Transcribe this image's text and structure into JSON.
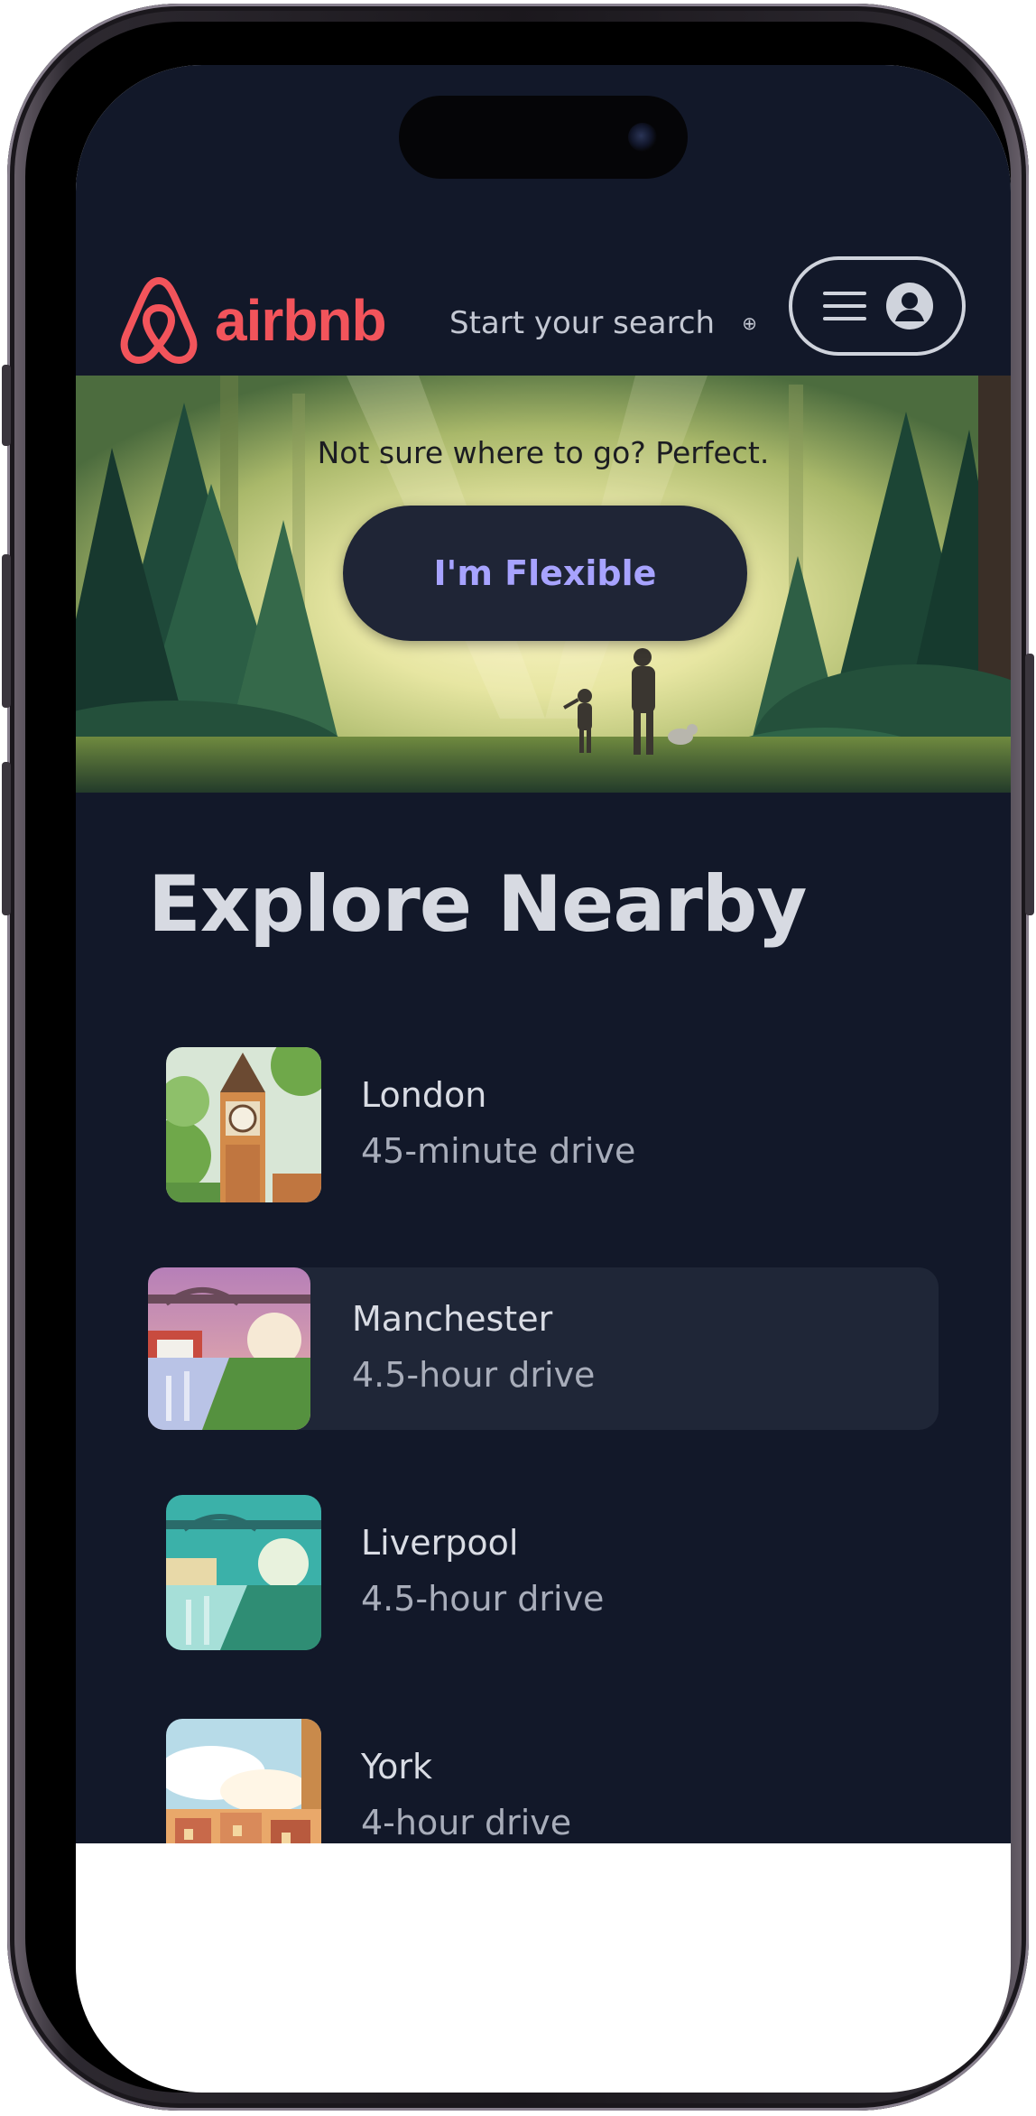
{
  "header": {
    "logo_text": "airbnb",
    "search_placeholder": "Start your search",
    "icons": [
      "airbnb-logo-icon",
      "globe-icon",
      "hamburger-menu-icon",
      "user-avatar-icon"
    ]
  },
  "hero": {
    "prompt": "Not sure where to go? Perfect.",
    "button_label": "I'm Flexible"
  },
  "explore": {
    "title": "Explore Nearby",
    "items": [
      {
        "name": "London",
        "drive": "45-minute drive"
      },
      {
        "name": "Manchester",
        "drive": "4.5-hour drive"
      },
      {
        "name": "Liverpool",
        "drive": "4.5-hour drive"
      },
      {
        "name": "York",
        "drive": "4-hour drive"
      }
    ]
  },
  "colors": {
    "background": "#121829",
    "brand": "#f2545b",
    "button_text": "#a7a3ff",
    "active_row": "#1f2637"
  }
}
